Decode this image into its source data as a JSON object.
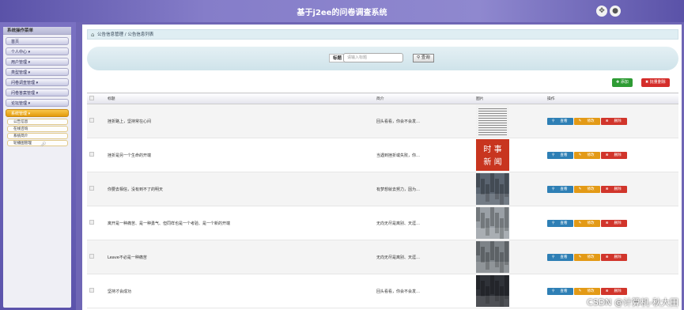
{
  "header": {
    "title": "基于j2ee的问卷调查系统"
  },
  "sidebar": {
    "title": "系统操作菜单",
    "items": [
      "首页",
      "个人中心 ▾",
      "用户管理 ▾",
      "类型管理 ▾",
      "问卷调查管理 ▾",
      "问卷答案管理 ▾",
      "论坛管理 ▾",
      "系统管理 ▾"
    ],
    "active_index": 7,
    "subitems": [
      "公告信息",
      "在线咨询",
      "系统简介",
      "轮播图管理"
    ]
  },
  "breadcrumb": [
    "公告信息管理",
    "公告信息列表"
  ],
  "search": {
    "label": "标题",
    "placeholder": "请输入标题",
    "button": "查询"
  },
  "toolbar": {
    "add": "✚ 添加",
    "batch_delete": "✖ 批量删除"
  },
  "table": {
    "headers": [
      "标题",
      "简介",
      "图片",
      "操作"
    ],
    "rows": [
      {
        "title": "挫折路上，坚持常在心间",
        "intro": "回头看看，你会不会发…",
        "img": "doc"
      },
      {
        "title": "挫折是另一个生命的开端",
        "intro": "当遇到挫折或失败，你…",
        "img": "news"
      },
      {
        "title": "你要去相信，没有到不了的明天",
        "intro": "有梦想就去努力，因为…",
        "img": "photo"
      },
      {
        "title": "离开是一种痛苦、是一种勇气、但同样也是一个考验、是一个新的开端",
        "intro": "无向无尽是离别、天涯…",
        "img": "street"
      },
      {
        "title": "Leave不必是一种痛苦",
        "intro": "无向无尽是离别、天涯…",
        "img": "gray"
      },
      {
        "title": "坚持才会成功",
        "intro": "回头看看，你会不会发…",
        "img": "dark"
      }
    ],
    "op_labels": {
      "view": "查看",
      "edit": "修改",
      "delete": "删除"
    }
  },
  "news_img_text": [
    "时 事",
    "新 闻"
  ],
  "watermark": "CSDN @计算机-秋大田"
}
